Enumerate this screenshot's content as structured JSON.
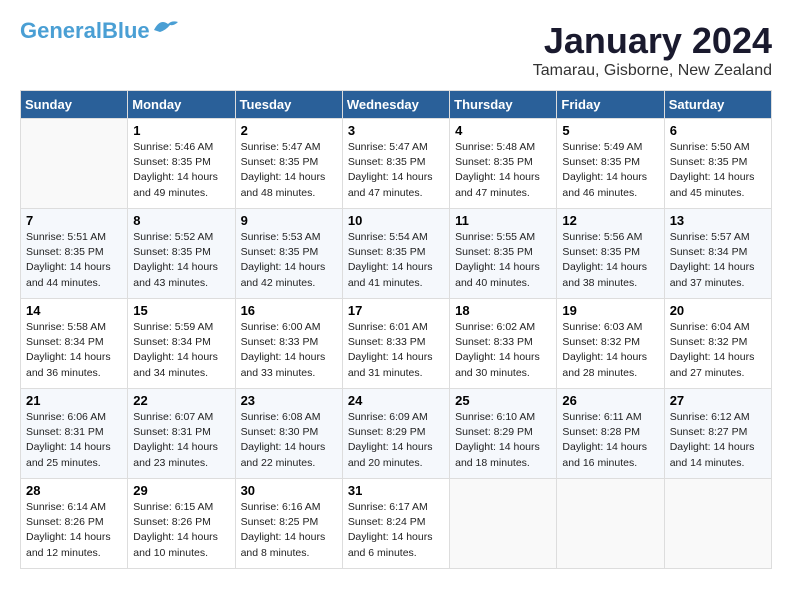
{
  "header": {
    "logo_line1": "General",
    "logo_line2": "Blue",
    "month_year": "January 2024",
    "location": "Tamarau, Gisborne, New Zealand"
  },
  "days_of_week": [
    "Sunday",
    "Monday",
    "Tuesday",
    "Wednesday",
    "Thursday",
    "Friday",
    "Saturday"
  ],
  "weeks": [
    [
      {
        "day": "",
        "info": ""
      },
      {
        "day": "1",
        "info": "Sunrise: 5:46 AM\nSunset: 8:35 PM\nDaylight: 14 hours\nand 49 minutes."
      },
      {
        "day": "2",
        "info": "Sunrise: 5:47 AM\nSunset: 8:35 PM\nDaylight: 14 hours\nand 48 minutes."
      },
      {
        "day": "3",
        "info": "Sunrise: 5:47 AM\nSunset: 8:35 PM\nDaylight: 14 hours\nand 47 minutes."
      },
      {
        "day": "4",
        "info": "Sunrise: 5:48 AM\nSunset: 8:35 PM\nDaylight: 14 hours\nand 47 minutes."
      },
      {
        "day": "5",
        "info": "Sunrise: 5:49 AM\nSunset: 8:35 PM\nDaylight: 14 hours\nand 46 minutes."
      },
      {
        "day": "6",
        "info": "Sunrise: 5:50 AM\nSunset: 8:35 PM\nDaylight: 14 hours\nand 45 minutes."
      }
    ],
    [
      {
        "day": "7",
        "info": "Sunrise: 5:51 AM\nSunset: 8:35 PM\nDaylight: 14 hours\nand 44 minutes."
      },
      {
        "day": "8",
        "info": "Sunrise: 5:52 AM\nSunset: 8:35 PM\nDaylight: 14 hours\nand 43 minutes."
      },
      {
        "day": "9",
        "info": "Sunrise: 5:53 AM\nSunset: 8:35 PM\nDaylight: 14 hours\nand 42 minutes."
      },
      {
        "day": "10",
        "info": "Sunrise: 5:54 AM\nSunset: 8:35 PM\nDaylight: 14 hours\nand 41 minutes."
      },
      {
        "day": "11",
        "info": "Sunrise: 5:55 AM\nSunset: 8:35 PM\nDaylight: 14 hours\nand 40 minutes."
      },
      {
        "day": "12",
        "info": "Sunrise: 5:56 AM\nSunset: 8:35 PM\nDaylight: 14 hours\nand 38 minutes."
      },
      {
        "day": "13",
        "info": "Sunrise: 5:57 AM\nSunset: 8:34 PM\nDaylight: 14 hours\nand 37 minutes."
      }
    ],
    [
      {
        "day": "14",
        "info": "Sunrise: 5:58 AM\nSunset: 8:34 PM\nDaylight: 14 hours\nand 36 minutes."
      },
      {
        "day": "15",
        "info": "Sunrise: 5:59 AM\nSunset: 8:34 PM\nDaylight: 14 hours\nand 34 minutes."
      },
      {
        "day": "16",
        "info": "Sunrise: 6:00 AM\nSunset: 8:33 PM\nDaylight: 14 hours\nand 33 minutes."
      },
      {
        "day": "17",
        "info": "Sunrise: 6:01 AM\nSunset: 8:33 PM\nDaylight: 14 hours\nand 31 minutes."
      },
      {
        "day": "18",
        "info": "Sunrise: 6:02 AM\nSunset: 8:33 PM\nDaylight: 14 hours\nand 30 minutes."
      },
      {
        "day": "19",
        "info": "Sunrise: 6:03 AM\nSunset: 8:32 PM\nDaylight: 14 hours\nand 28 minutes."
      },
      {
        "day": "20",
        "info": "Sunrise: 6:04 AM\nSunset: 8:32 PM\nDaylight: 14 hours\nand 27 minutes."
      }
    ],
    [
      {
        "day": "21",
        "info": "Sunrise: 6:06 AM\nSunset: 8:31 PM\nDaylight: 14 hours\nand 25 minutes."
      },
      {
        "day": "22",
        "info": "Sunrise: 6:07 AM\nSunset: 8:31 PM\nDaylight: 14 hours\nand 23 minutes."
      },
      {
        "day": "23",
        "info": "Sunrise: 6:08 AM\nSunset: 8:30 PM\nDaylight: 14 hours\nand 22 minutes."
      },
      {
        "day": "24",
        "info": "Sunrise: 6:09 AM\nSunset: 8:29 PM\nDaylight: 14 hours\nand 20 minutes."
      },
      {
        "day": "25",
        "info": "Sunrise: 6:10 AM\nSunset: 8:29 PM\nDaylight: 14 hours\nand 18 minutes."
      },
      {
        "day": "26",
        "info": "Sunrise: 6:11 AM\nSunset: 8:28 PM\nDaylight: 14 hours\nand 16 minutes."
      },
      {
        "day": "27",
        "info": "Sunrise: 6:12 AM\nSunset: 8:27 PM\nDaylight: 14 hours\nand 14 minutes."
      }
    ],
    [
      {
        "day": "28",
        "info": "Sunrise: 6:14 AM\nSunset: 8:26 PM\nDaylight: 14 hours\nand 12 minutes."
      },
      {
        "day": "29",
        "info": "Sunrise: 6:15 AM\nSunset: 8:26 PM\nDaylight: 14 hours\nand 10 minutes."
      },
      {
        "day": "30",
        "info": "Sunrise: 6:16 AM\nSunset: 8:25 PM\nDaylight: 14 hours\nand 8 minutes."
      },
      {
        "day": "31",
        "info": "Sunrise: 6:17 AM\nSunset: 8:24 PM\nDaylight: 14 hours\nand 6 minutes."
      },
      {
        "day": "",
        "info": ""
      },
      {
        "day": "",
        "info": ""
      },
      {
        "day": "",
        "info": ""
      }
    ]
  ]
}
